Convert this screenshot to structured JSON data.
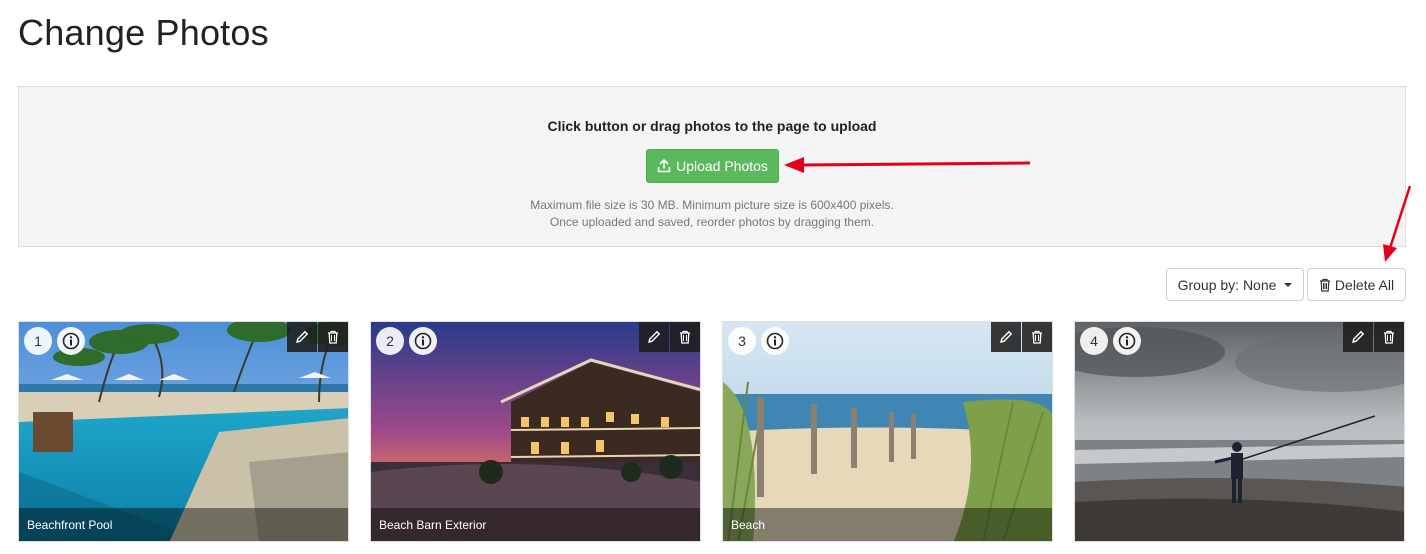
{
  "page": {
    "title": "Change Photos"
  },
  "upload": {
    "heading": "Click button or drag photos to the page to upload",
    "button_label": "Upload Photos",
    "note_line1": "Maximum file size is 30 MB. Minimum picture size is 600x400 pixels.",
    "note_line2": "Once uploaded and saved, reorder photos by dragging them."
  },
  "toolbar": {
    "group_by_label": "Group by: None",
    "delete_all_label": "Delete All"
  },
  "photos": [
    {
      "number": "1",
      "caption": "Beachfront Pool"
    },
    {
      "number": "2",
      "caption": "Beach Barn Exterior"
    },
    {
      "number": "3",
      "caption": "Beach"
    },
    {
      "number": "4",
      "caption": ""
    }
  ],
  "colors": {
    "upload_button": "#5cb85c",
    "annotation_arrow": "#e3001b",
    "panel_background": "#f4f4f4"
  }
}
